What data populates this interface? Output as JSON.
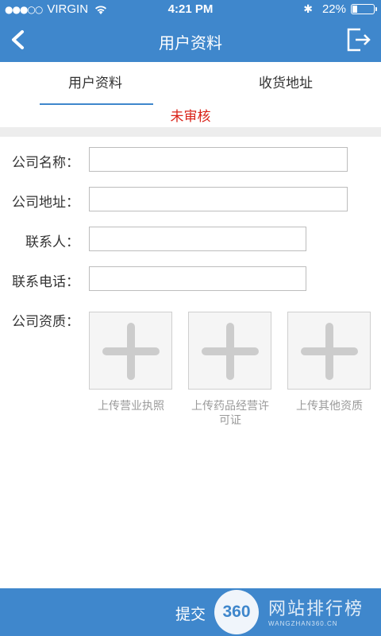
{
  "status_bar": {
    "signal_dots": "●●●○○",
    "carrier": "VIRGIN",
    "time": "4:21 PM",
    "battery_text": "22%",
    "battery_level": 0.22
  },
  "nav": {
    "title": "用户资料",
    "back_icon": "chevron-left-icon",
    "exit_icon": "exit-icon"
  },
  "tabs": [
    {
      "label": "用户资料",
      "active": true
    },
    {
      "label": "收货地址",
      "active": false
    }
  ],
  "review_status": "未审核",
  "form": {
    "company_name": {
      "label": "公司名称：",
      "value": ""
    },
    "company_address": {
      "label": "公司地址：",
      "value": ""
    },
    "contact_person": {
      "label": "联系人：",
      "value": ""
    },
    "contact_phone": {
      "label": "联系电话：",
      "value": ""
    },
    "qualification": {
      "label": "公司资质："
    }
  },
  "uploads": [
    {
      "caption": "上传营业执照"
    },
    {
      "caption": "上传药品经营许可证"
    },
    {
      "caption": "上传其他资质"
    }
  ],
  "submit_label": "提交",
  "watermark": {
    "badge": "360",
    "main": "网站排行榜",
    "sub": "WANGZHAN360.CN"
  },
  "colors": {
    "primary": "#3f87cc",
    "review_status": "#d9241a"
  }
}
